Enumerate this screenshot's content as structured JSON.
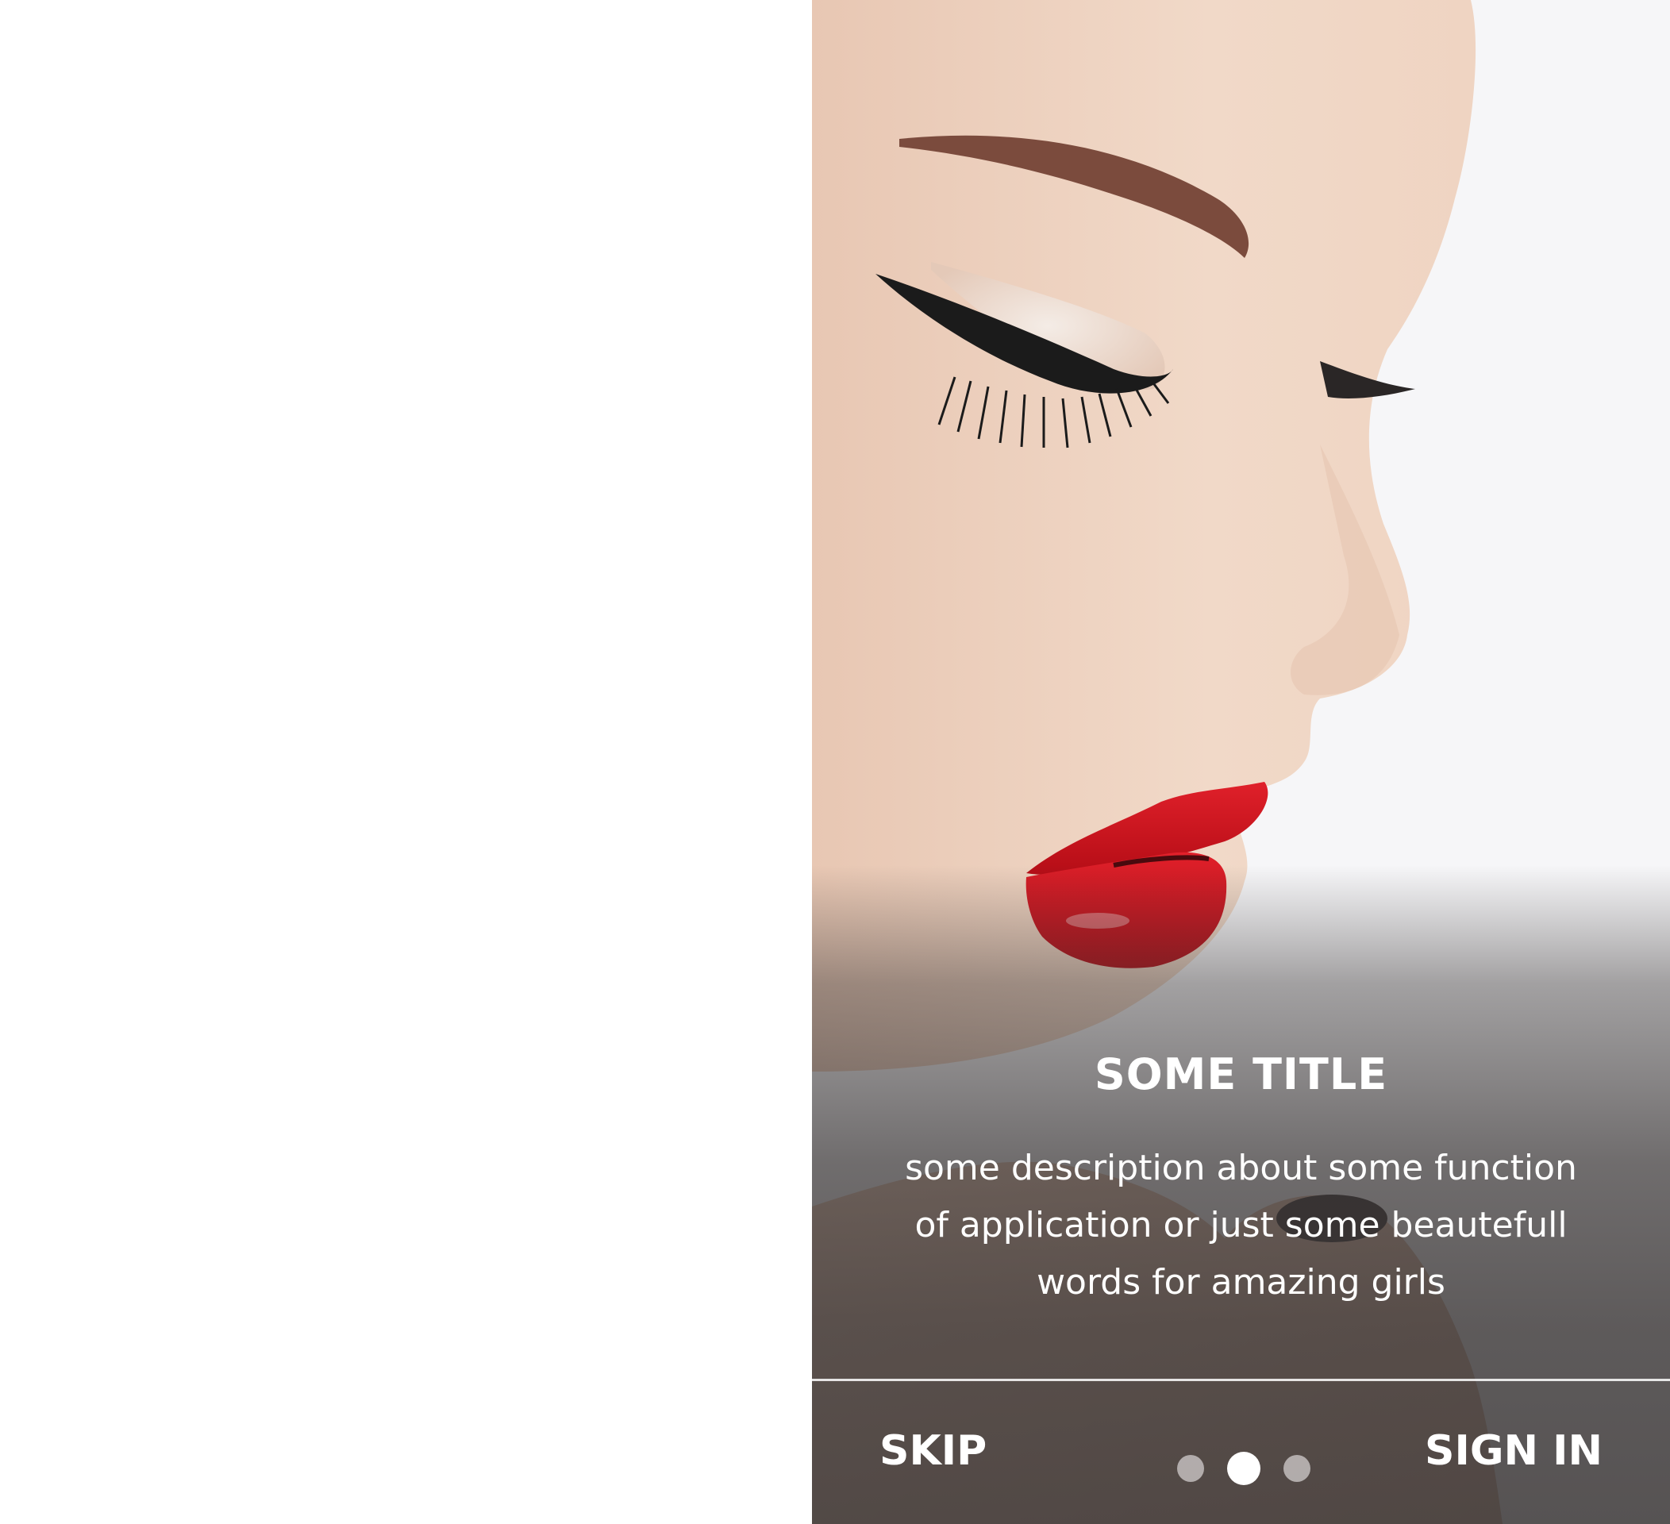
{
  "onboarding": {
    "title": "SOME TITLE",
    "description": "some description about some function of application or just some beautefull words for amazing girls",
    "skip_label": "SKIP",
    "sign_in_label": "SIGN IN",
    "pagination": {
      "total": 3,
      "active_index": 1
    }
  },
  "hero_image": {
    "subject": "woman profile with closed eyes and red lips"
  },
  "colors": {
    "lip_red": "#d8151f",
    "overlay": "#3c3838",
    "text": "#ffffff"
  }
}
